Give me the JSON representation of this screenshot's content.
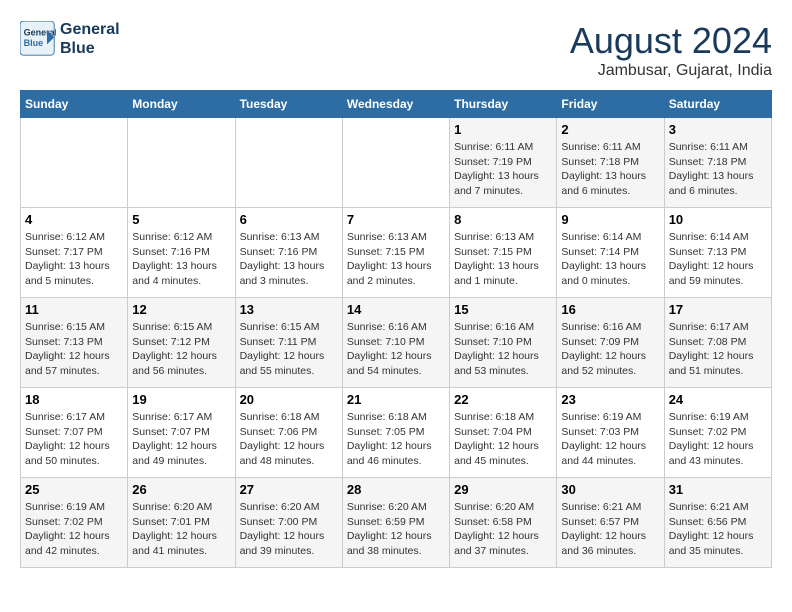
{
  "header": {
    "logo_line1": "General",
    "logo_line2": "Blue",
    "title": "August 2024",
    "subtitle": "Jambusar, Gujarat, India"
  },
  "days_of_week": [
    "Sunday",
    "Monday",
    "Tuesday",
    "Wednesday",
    "Thursday",
    "Friday",
    "Saturday"
  ],
  "weeks": [
    [
      {
        "day": "",
        "info": ""
      },
      {
        "day": "",
        "info": ""
      },
      {
        "day": "",
        "info": ""
      },
      {
        "day": "",
        "info": ""
      },
      {
        "day": "1",
        "info": "Sunrise: 6:11 AM\nSunset: 7:19 PM\nDaylight: 13 hours\nand 7 minutes."
      },
      {
        "day": "2",
        "info": "Sunrise: 6:11 AM\nSunset: 7:18 PM\nDaylight: 13 hours\nand 6 minutes."
      },
      {
        "day": "3",
        "info": "Sunrise: 6:11 AM\nSunset: 7:18 PM\nDaylight: 13 hours\nand 6 minutes."
      }
    ],
    [
      {
        "day": "4",
        "info": "Sunrise: 6:12 AM\nSunset: 7:17 PM\nDaylight: 13 hours\nand 5 minutes."
      },
      {
        "day": "5",
        "info": "Sunrise: 6:12 AM\nSunset: 7:16 PM\nDaylight: 13 hours\nand 4 minutes."
      },
      {
        "day": "6",
        "info": "Sunrise: 6:13 AM\nSunset: 7:16 PM\nDaylight: 13 hours\nand 3 minutes."
      },
      {
        "day": "7",
        "info": "Sunrise: 6:13 AM\nSunset: 7:15 PM\nDaylight: 13 hours\nand 2 minutes."
      },
      {
        "day": "8",
        "info": "Sunrise: 6:13 AM\nSunset: 7:15 PM\nDaylight: 13 hours\nand 1 minute."
      },
      {
        "day": "9",
        "info": "Sunrise: 6:14 AM\nSunset: 7:14 PM\nDaylight: 13 hours\nand 0 minutes."
      },
      {
        "day": "10",
        "info": "Sunrise: 6:14 AM\nSunset: 7:13 PM\nDaylight: 12 hours\nand 59 minutes."
      }
    ],
    [
      {
        "day": "11",
        "info": "Sunrise: 6:15 AM\nSunset: 7:13 PM\nDaylight: 12 hours\nand 57 minutes."
      },
      {
        "day": "12",
        "info": "Sunrise: 6:15 AM\nSunset: 7:12 PM\nDaylight: 12 hours\nand 56 minutes."
      },
      {
        "day": "13",
        "info": "Sunrise: 6:15 AM\nSunset: 7:11 PM\nDaylight: 12 hours\nand 55 minutes."
      },
      {
        "day": "14",
        "info": "Sunrise: 6:16 AM\nSunset: 7:10 PM\nDaylight: 12 hours\nand 54 minutes."
      },
      {
        "day": "15",
        "info": "Sunrise: 6:16 AM\nSunset: 7:10 PM\nDaylight: 12 hours\nand 53 minutes."
      },
      {
        "day": "16",
        "info": "Sunrise: 6:16 AM\nSunset: 7:09 PM\nDaylight: 12 hours\nand 52 minutes."
      },
      {
        "day": "17",
        "info": "Sunrise: 6:17 AM\nSunset: 7:08 PM\nDaylight: 12 hours\nand 51 minutes."
      }
    ],
    [
      {
        "day": "18",
        "info": "Sunrise: 6:17 AM\nSunset: 7:07 PM\nDaylight: 12 hours\nand 50 minutes."
      },
      {
        "day": "19",
        "info": "Sunrise: 6:17 AM\nSunset: 7:07 PM\nDaylight: 12 hours\nand 49 minutes."
      },
      {
        "day": "20",
        "info": "Sunrise: 6:18 AM\nSunset: 7:06 PM\nDaylight: 12 hours\nand 48 minutes."
      },
      {
        "day": "21",
        "info": "Sunrise: 6:18 AM\nSunset: 7:05 PM\nDaylight: 12 hours\nand 46 minutes."
      },
      {
        "day": "22",
        "info": "Sunrise: 6:18 AM\nSunset: 7:04 PM\nDaylight: 12 hours\nand 45 minutes."
      },
      {
        "day": "23",
        "info": "Sunrise: 6:19 AM\nSunset: 7:03 PM\nDaylight: 12 hours\nand 44 minutes."
      },
      {
        "day": "24",
        "info": "Sunrise: 6:19 AM\nSunset: 7:02 PM\nDaylight: 12 hours\nand 43 minutes."
      }
    ],
    [
      {
        "day": "25",
        "info": "Sunrise: 6:19 AM\nSunset: 7:02 PM\nDaylight: 12 hours\nand 42 minutes."
      },
      {
        "day": "26",
        "info": "Sunrise: 6:20 AM\nSunset: 7:01 PM\nDaylight: 12 hours\nand 41 minutes."
      },
      {
        "day": "27",
        "info": "Sunrise: 6:20 AM\nSunset: 7:00 PM\nDaylight: 12 hours\nand 39 minutes."
      },
      {
        "day": "28",
        "info": "Sunrise: 6:20 AM\nSunset: 6:59 PM\nDaylight: 12 hours\nand 38 minutes."
      },
      {
        "day": "29",
        "info": "Sunrise: 6:20 AM\nSunset: 6:58 PM\nDaylight: 12 hours\nand 37 minutes."
      },
      {
        "day": "30",
        "info": "Sunrise: 6:21 AM\nSunset: 6:57 PM\nDaylight: 12 hours\nand 36 minutes."
      },
      {
        "day": "31",
        "info": "Sunrise: 6:21 AM\nSunset: 6:56 PM\nDaylight: 12 hours\nand 35 minutes."
      }
    ]
  ]
}
